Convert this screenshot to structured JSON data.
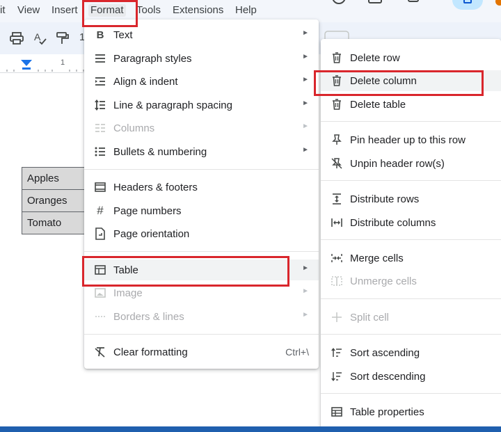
{
  "menubar": {
    "items": [
      {
        "label": "it",
        "name": "menu-edit"
      },
      {
        "label": "View",
        "name": "menu-view"
      },
      {
        "label": "Insert",
        "name": "menu-insert"
      },
      {
        "label": "Format",
        "name": "menu-format"
      },
      {
        "label": "Tools",
        "name": "menu-tools"
      },
      {
        "label": "Extensions",
        "name": "menu-extensions"
      },
      {
        "label": "Help",
        "name": "menu-help"
      }
    ]
  },
  "toolbar": {
    "icons": [
      "print-icon",
      "spellcheck-icon",
      "paint-format-icon"
    ],
    "partial_text": "1"
  },
  "ruler": {
    "mark": "1"
  },
  "document": {
    "table_rows": [
      "Apples",
      "Oranges",
      "Tomato"
    ]
  },
  "format_menu": {
    "items": [
      {
        "label": "Text",
        "icon": "bold-icon",
        "submenu": true,
        "disabled": false
      },
      {
        "label": "Paragraph styles",
        "icon": "paragraph-styles-icon",
        "submenu": true,
        "disabled": false
      },
      {
        "label": "Align & indent",
        "icon": "align-indent-icon",
        "submenu": true,
        "disabled": false
      },
      {
        "label": "Line & paragraph spacing",
        "icon": "line-spacing-icon",
        "submenu": true,
        "disabled": false
      },
      {
        "label": "Columns",
        "icon": "columns-icon",
        "submenu": true,
        "disabled": true
      },
      {
        "label": "Bullets & numbering",
        "icon": "bullets-icon",
        "submenu": true,
        "disabled": false
      },
      {
        "label": "Headers & footers",
        "icon": "headers-footers-icon",
        "submenu": false,
        "disabled": false
      },
      {
        "label": "Page numbers",
        "icon": "page-numbers-icon",
        "submenu": false,
        "disabled": false
      },
      {
        "label": "Page orientation",
        "icon": "page-orientation-icon",
        "submenu": false,
        "disabled": false
      },
      {
        "label": "Table",
        "icon": "table-icon",
        "submenu": true,
        "disabled": false
      },
      {
        "label": "Image",
        "icon": "image-icon",
        "submenu": true,
        "disabled": true
      },
      {
        "label": "Borders & lines",
        "icon": "borders-icon",
        "submenu": true,
        "disabled": true
      },
      {
        "label": "Clear formatting",
        "icon": "clear-formatting-icon",
        "submenu": false,
        "disabled": false,
        "shortcut": "Ctrl+\\"
      }
    ]
  },
  "table_menu": {
    "items": [
      {
        "label": "Delete row",
        "icon": "trash-icon",
        "disabled": false
      },
      {
        "label": "Delete column",
        "icon": "trash-icon",
        "disabled": false
      },
      {
        "label": "Delete table",
        "icon": "trash-icon",
        "disabled": false
      },
      {
        "label": "Pin header up to this row",
        "icon": "pin-icon",
        "disabled": false
      },
      {
        "label": "Unpin header row(s)",
        "icon": "unpin-icon",
        "disabled": false
      },
      {
        "label": "Distribute rows",
        "icon": "distribute-rows-icon",
        "disabled": false
      },
      {
        "label": "Distribute columns",
        "icon": "distribute-columns-icon",
        "disabled": false
      },
      {
        "label": "Merge cells",
        "icon": "merge-cells-icon",
        "disabled": false
      },
      {
        "label": "Unmerge cells",
        "icon": "unmerge-cells-icon",
        "disabled": true
      },
      {
        "label": "Split cell",
        "icon": "split-cell-icon",
        "disabled": true
      },
      {
        "label": "Sort ascending",
        "icon": "sort-ascending-icon",
        "disabled": false
      },
      {
        "label": "Sort descending",
        "icon": "sort-descending-icon",
        "disabled": false
      },
      {
        "label": "Table properties",
        "icon": "table-properties-icon",
        "disabled": false
      }
    ]
  },
  "colors": {
    "highlight_box": "#d9262c",
    "menubar_bg": "#f3f6fb",
    "toolbar_bg": "#edf2fa",
    "table_cell_bg": "#d9d9d9"
  }
}
